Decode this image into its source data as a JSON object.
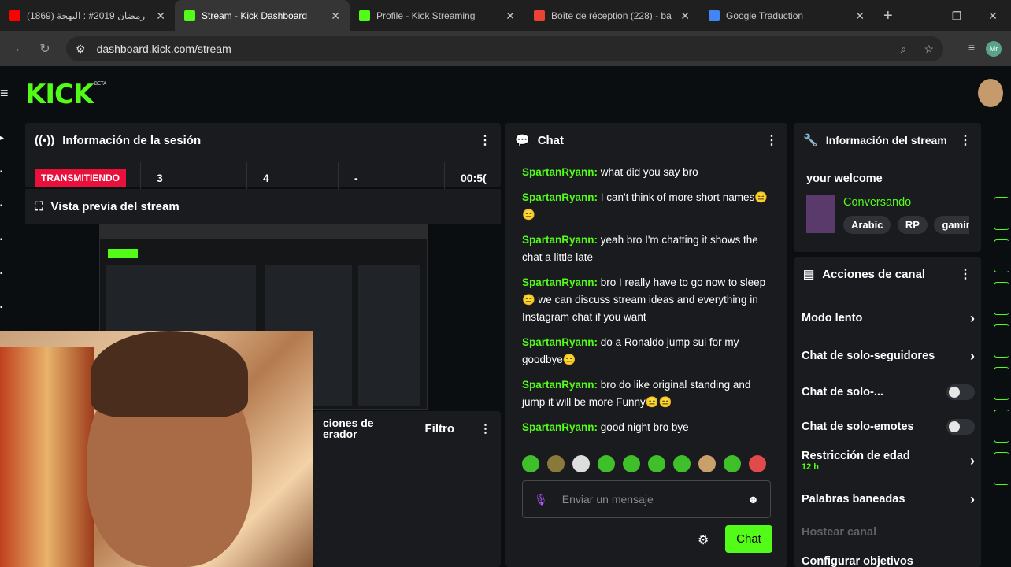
{
  "browser": {
    "tabs": [
      {
        "title": "(1869) رمضان 2019# : البهجة",
        "icon": "youtube-icon",
        "color": "#ff0000"
      },
      {
        "title": "Stream - Kick Dashboard",
        "icon": "kick-icon",
        "color": "#53fc18",
        "active": true
      },
      {
        "title": "Profile - Kick Streaming",
        "icon": "kick-icon",
        "color": "#53fc18"
      },
      {
        "title": "Boîte de réception (228) - ba",
        "icon": "gmail-icon",
        "color": "#ea4335"
      },
      {
        "title": "Google Traduction",
        "icon": "translate-icon",
        "color": "#4285f4"
      }
    ],
    "url": "dashboard.kick.com/stream",
    "profile_initials": "Mr"
  },
  "header": {
    "logo": "KICK",
    "beta": "BETA"
  },
  "session": {
    "title": "Información de la sesión",
    "live_label": "TRANSMITIENDO",
    "stats": [
      "3",
      "4",
      "-",
      "00:5("
    ]
  },
  "preview": {
    "title": "Vista previa del stream"
  },
  "moderator": {
    "title": "ciones de\nerador",
    "filter": "Filtro"
  },
  "chat": {
    "title": "Chat",
    "messages": [
      {
        "user": "SpartanRyann:",
        "text": "what did you say bro"
      },
      {
        "user": "SpartanRyann:",
        "text": "I can't think of more short names😑😑"
      },
      {
        "user": "SpartanRyann:",
        "text": "yeah bro I'm chatting it shows the chat a little late"
      },
      {
        "user": "SpartanRyann:",
        "text": "bro I really have to go now to sleep😑 we can discuss stream ideas and everything in Instagram chat if you want"
      },
      {
        "user": "SpartanRyann:",
        "text": "do a Ronaldo jump sui for my goodbye😑"
      },
      {
        "user": "SpartanRyann:",
        "text": "bro do like original standing and jump it will be more Funny😑😑"
      },
      {
        "user": "SpartanRyann:",
        "text": "good night bro bye"
      }
    ],
    "placeholder": "Enviar un mensaje",
    "send_label": "Chat"
  },
  "stream_info": {
    "title": "Información del stream",
    "stream_title": "your welcome",
    "category": "Conversando",
    "tags": [
      "Arabic",
      "RP",
      "gaming"
    ]
  },
  "channel_actions": {
    "title": "Acciones de canal",
    "items": [
      {
        "label": "Modo lento",
        "kind": "chevron"
      },
      {
        "label": "Chat de solo-seguidores",
        "kind": "chevron"
      },
      {
        "label": "Chat de solo-...",
        "kind": "toggle"
      },
      {
        "label": "Chat de solo-emotes",
        "kind": "toggle"
      },
      {
        "label": "Restricción de edad",
        "sub": "12 h",
        "kind": "chevron"
      },
      {
        "label": "Palabras baneadas",
        "kind": "chevron"
      },
      {
        "label": "Hostear canal",
        "kind": "disabled"
      },
      {
        "label": "Configurar objetivos",
        "kind": "chevron"
      }
    ]
  }
}
